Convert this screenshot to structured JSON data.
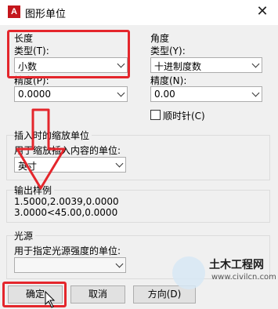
{
  "window": {
    "title": "图形单位",
    "app_icon_letter": "A",
    "close_glyph": "✕"
  },
  "length": {
    "group_label": "长度",
    "type_label": "类型(T):",
    "type_value": "小数",
    "precision_label": "精度(P):",
    "precision_value": "0.0000"
  },
  "angle": {
    "group_label": "角度",
    "type_label": "类型(Y):",
    "type_value": "十进制度数",
    "precision_label": "精度(N):",
    "precision_value": "0.00",
    "clockwise_label": "顺时针(C)",
    "clockwise_checked": false
  },
  "insertion": {
    "group_label": "插入时的缩放单位",
    "units_label": "用于缩放插入内容的单位:",
    "units_value": "英寸"
  },
  "sample": {
    "group_label": "输出样例",
    "line1": "1.5000,2.0039,0.0000",
    "line2": "3.0000<45.00,0.0000"
  },
  "lighting": {
    "group_label": "光源",
    "units_label": "用于指定光源强度的单位:",
    "units_value": ""
  },
  "buttons": {
    "ok": "确定",
    "cancel": "取消",
    "direction": "方向(D)"
  },
  "watermark": {
    "logo_text": "土木工程网",
    "url": "www.civilcn.com"
  },
  "colors": {
    "highlight_red": "#e4262c",
    "arrow_red": "#e4262c"
  }
}
